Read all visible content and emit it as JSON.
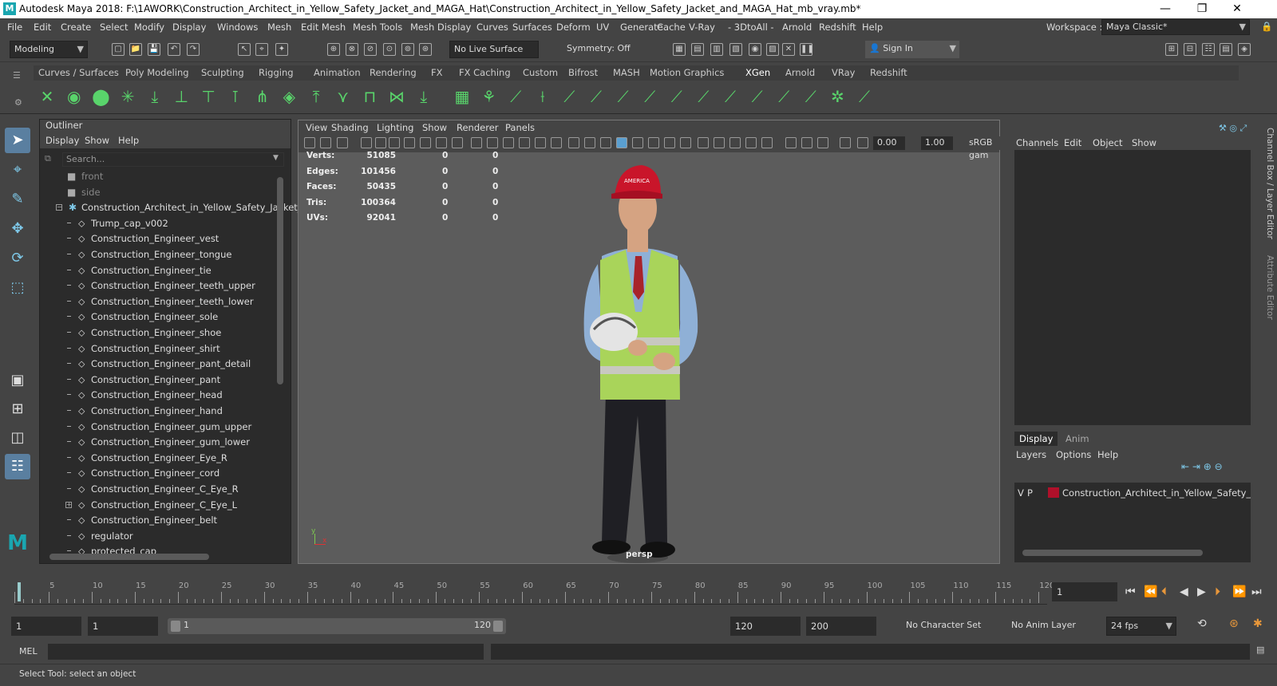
{
  "title": "Autodesk Maya 2018: F:\\1AWORK\\Construction_Architect_in_Yellow_Safety_Jacket_and_MAGA_Hat\\Construction_Architect_in_Yellow_Safety_Jacket_and_MAGA_Hat_mb_vray.mb*",
  "window_controls": {
    "minimize": "—",
    "restore": "❐",
    "close": "✕"
  },
  "menus": [
    "File",
    "Edit",
    "Create",
    "Select",
    "Modify",
    "Display",
    "Windows",
    "Mesh",
    "Edit Mesh",
    "Mesh Tools",
    "Mesh Display",
    "Curves",
    "Surfaces",
    "Deform",
    "UV",
    "Generate",
    "Cache",
    "V-Ray",
    "- 3DtoAll -",
    "Arnold",
    "Redshift",
    "Help"
  ],
  "workspace": {
    "label": "Workspace :",
    "value": "Maya Classic*"
  },
  "toolbar": {
    "mode": "Modeling",
    "live_surface": "No Live Surface",
    "symmetry": "Symmetry: Off",
    "sign_in": "Sign In"
  },
  "shelf_tabs": [
    "Curves / Surfaces",
    "Poly Modeling",
    "Sculpting",
    "Rigging",
    "Animation",
    "Rendering",
    "FX",
    "FX Caching",
    "Custom",
    "Bifrost",
    "MASH",
    "Motion Graphics",
    "XGen",
    "Arnold",
    "VRay",
    "Redshift"
  ],
  "shelf_active": "XGen",
  "outliner": {
    "title": "Outliner",
    "menu": [
      "Display",
      "Show",
      "Help"
    ],
    "search_placeholder": "Search...",
    "rows": [
      {
        "name": "front",
        "type": "camera",
        "dim": true
      },
      {
        "name": "side",
        "type": "camera",
        "dim": true
      },
      {
        "name": "Construction_Architect_in_Yellow_Safety_Jacket_a",
        "type": "group",
        "expanded": true
      },
      {
        "name": "Trump_cap_v002",
        "type": "mesh"
      },
      {
        "name": "Construction_Engineer_vest",
        "type": "mesh"
      },
      {
        "name": "Construction_Engineer_tongue",
        "type": "mesh"
      },
      {
        "name": "Construction_Engineer_tie",
        "type": "mesh"
      },
      {
        "name": "Construction_Engineer_teeth_upper",
        "type": "mesh"
      },
      {
        "name": "Construction_Engineer_teeth_lower",
        "type": "mesh"
      },
      {
        "name": "Construction_Engineer_sole",
        "type": "mesh"
      },
      {
        "name": "Construction_Engineer_shoe",
        "type": "mesh"
      },
      {
        "name": "Construction_Engineer_shirt",
        "type": "mesh"
      },
      {
        "name": "Construction_Engineer_pant_detail",
        "type": "mesh"
      },
      {
        "name": "Construction_Engineer_pant",
        "type": "mesh"
      },
      {
        "name": "Construction_Engineer_head",
        "type": "mesh"
      },
      {
        "name": "Construction_Engineer_hand",
        "type": "mesh"
      },
      {
        "name": "Construction_Engineer_gum_upper",
        "type": "mesh"
      },
      {
        "name": "Construction_Engineer_gum_lower",
        "type": "mesh"
      },
      {
        "name": "Construction_Engineer_Eye_R",
        "type": "mesh"
      },
      {
        "name": "Construction_Engineer_cord",
        "type": "mesh"
      },
      {
        "name": "Construction_Engineer_C_Eye_R",
        "type": "mesh"
      },
      {
        "name": "Construction_Engineer_C_Eye_L",
        "type": "mesh",
        "collapsed": true
      },
      {
        "name": "Construction_Engineer_belt",
        "type": "mesh"
      },
      {
        "name": "regulator",
        "type": "mesh"
      },
      {
        "name": "protected_cap",
        "type": "mesh"
      }
    ]
  },
  "viewport": {
    "menu": [
      "View",
      "Shading",
      "Lighting",
      "Show",
      "Renderer",
      "Panels"
    ],
    "field1": "0.00",
    "field2": "1.00",
    "colorspace": "sRGB gam",
    "camera": "persp",
    "hud": [
      {
        "label": "Verts:",
        "value": "51085",
        "sel": "0",
        "comp": "0"
      },
      {
        "label": "Edges:",
        "value": "101456",
        "sel": "0",
        "comp": "0"
      },
      {
        "label": "Faces:",
        "value": "50435",
        "sel": "0",
        "comp": "0"
      },
      {
        "label": "Tris:",
        "value": "100364",
        "sel": "0",
        "comp": "0"
      },
      {
        "label": "UVs:",
        "value": "92041",
        "sel": "0",
        "comp": "0"
      }
    ]
  },
  "channel_box": {
    "menu": [
      "Channels",
      "Edit",
      "Object",
      "Show"
    ],
    "layer_tabs": [
      "Display",
      "Anim"
    ],
    "layer_menu": [
      "Layers",
      "Options",
      "Help"
    ],
    "layer": {
      "v": "V",
      "p": "P",
      "color": "#b0102a",
      "name": "Construction_Architect_in_Yellow_Safety_Jacke"
    }
  },
  "side_tabs": [
    "Channel Box / Layer Editor",
    "Attribute Editor"
  ],
  "timeline": {
    "ticks": [
      1,
      5,
      10,
      15,
      20,
      25,
      30,
      35,
      40,
      45,
      50,
      55,
      60,
      65,
      70,
      75,
      80,
      85,
      90,
      95,
      100,
      105,
      110,
      115,
      120
    ],
    "current_frame": "1"
  },
  "range": {
    "start": "1",
    "playback_start": "1",
    "slider_start": "1",
    "slider_end": "120",
    "playback_end": "120",
    "end": "200",
    "character_set": "No Character Set",
    "anim_layer": "No Anim Layer",
    "fps": "24 fps"
  },
  "command_line": {
    "label": "MEL"
  },
  "status_text": "Select Tool: select an object"
}
